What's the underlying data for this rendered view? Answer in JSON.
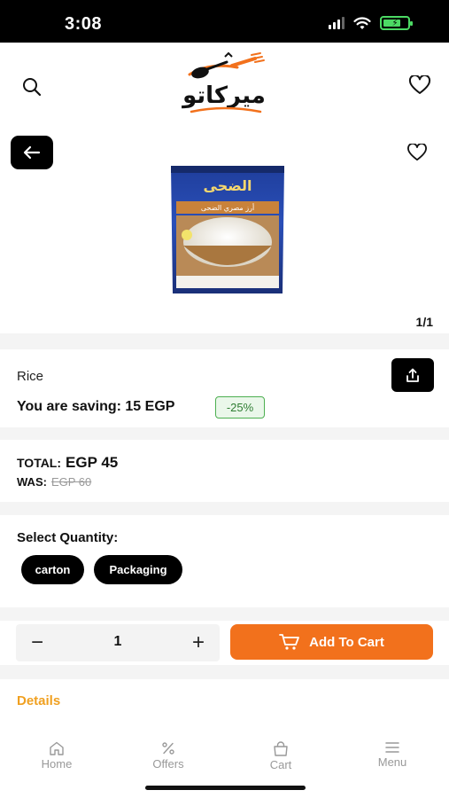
{
  "status_bar": {
    "time": "3:08"
  },
  "header": {
    "logo_text": "ميركاتو"
  },
  "gallery": {
    "counter": "1/1",
    "package_brand": "الضحى",
    "package_subtitle": "أرز مصري الضحى"
  },
  "product": {
    "name": "Rice",
    "saving_text": "You are saving: 15 EGP",
    "discount": "-25%"
  },
  "price": {
    "total_label": "TOTAL:",
    "total_value": "EGP 45",
    "was_label": "WAS:",
    "was_value": "EGP 60"
  },
  "quantity": {
    "title": "Select Quantity:",
    "options": [
      "carton",
      "Packaging"
    ]
  },
  "cart": {
    "minus_symbol": "−",
    "plus_symbol": "+",
    "quantity_value": "1",
    "add_label": "Add To Cart"
  },
  "details": {
    "label": "Details"
  },
  "nav": {
    "items": [
      {
        "label": "Home",
        "icon": "home-icon"
      },
      {
        "label": "Offers",
        "icon": "percent-icon"
      },
      {
        "label": "Cart",
        "icon": "bag-icon"
      },
      {
        "label": "Menu",
        "icon": "menu-icon"
      }
    ]
  },
  "colors": {
    "accent": "#f2711c",
    "details": "#f0a020",
    "discount": "#4caf50"
  }
}
